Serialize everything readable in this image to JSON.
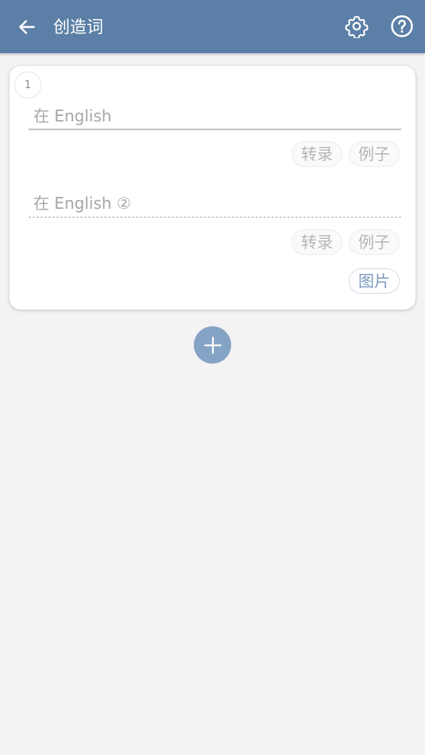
{
  "header": {
    "title": "创造词",
    "icons": {
      "back": "arrow-left-icon",
      "settings": "gear-icon",
      "help": "help-circle-icon"
    }
  },
  "card": {
    "index": "1",
    "fields": [
      {
        "placeholder": "在 English"
      },
      {
        "placeholder": "在 English ②"
      }
    ],
    "buttons": {
      "transcribe": "转录",
      "example": "例子",
      "image": "图片"
    }
  },
  "fab": {
    "icon": "plus-icon"
  },
  "colors": {
    "appbar": "#5b7fa6",
    "fab": "#85a3c5",
    "background": "#f3f3f3"
  }
}
